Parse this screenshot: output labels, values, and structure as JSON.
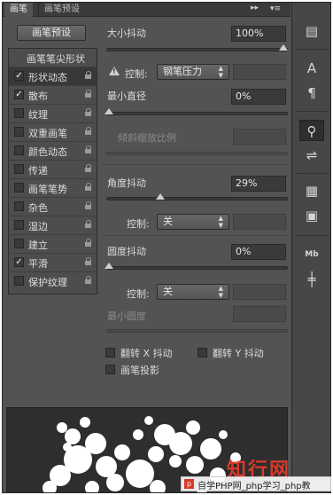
{
  "tabs": [
    {
      "label": "画笔",
      "active": true
    },
    {
      "label": "画笔预设",
      "active": false
    }
  ],
  "panel": {
    "collapse_glyph": "▸▸",
    "menu_glyph": "▾≡"
  },
  "preset_button": "画笔预设",
  "list": {
    "header": "画笔笔尖形状",
    "items": [
      {
        "label": "形状动态",
        "checked": true,
        "selected": true
      },
      {
        "label": "散布",
        "checked": true,
        "selected": false
      },
      {
        "label": "纹理",
        "checked": false,
        "selected": false
      },
      {
        "label": "双重画笔",
        "checked": false,
        "selected": false
      },
      {
        "label": "颜色动态",
        "checked": false,
        "selected": false
      },
      {
        "label": "传递",
        "checked": false,
        "selected": false
      },
      {
        "label": "画笔笔势",
        "checked": false,
        "selected": false
      },
      {
        "label": "杂色",
        "checked": false,
        "selected": false
      },
      {
        "label": "湿边",
        "checked": false,
        "selected": false
      },
      {
        "label": "建立",
        "checked": false,
        "selected": false
      },
      {
        "label": "平滑",
        "checked": true,
        "selected": false
      },
      {
        "label": "保护纹理",
        "checked": false,
        "selected": false
      }
    ]
  },
  "settings": {
    "size_jitter": {
      "label": "大小抖动",
      "value": "100%",
      "level": 1.0
    },
    "control1": {
      "label": "控制:",
      "value": "钢笔压力"
    },
    "min_diameter": {
      "label": "最小直径",
      "value": "0%",
      "level": 0.0
    },
    "tilt_scale": {
      "label": "倾斜缩放比例"
    },
    "angle_jitter": {
      "label": "角度抖动",
      "value": "29%",
      "level": 0.29
    },
    "control2": {
      "label": "控制:",
      "value": "关"
    },
    "roundness_jitter": {
      "label": "圆度抖动",
      "value": "0%",
      "level": 0.0
    },
    "control3": {
      "label": "控制:",
      "value": "关"
    },
    "min_roundness": {
      "label": "最小圆度"
    },
    "flip_x": {
      "label": "翻转 X 抖动",
      "checked": false
    },
    "flip_y": {
      "label": "翻转 Y 抖动",
      "checked": false
    },
    "brush_projection": {
      "label": "画笔投影",
      "checked": false
    }
  },
  "toolbar": {
    "icons": [
      "brush-settings-icon",
      "character-icon",
      "paragraph-icon",
      "brush-icon",
      "tool-presets-icon",
      "document-icon",
      "notes-icon",
      "layer-comps-icon",
      "measurement-icon"
    ]
  },
  "watermark": {
    "logo": "知行网",
    "bar_text": "自学PHP网_php学习_php教"
  },
  "colors": {
    "panel_bg": "#535353",
    "accent_red": "#d83a2a"
  }
}
